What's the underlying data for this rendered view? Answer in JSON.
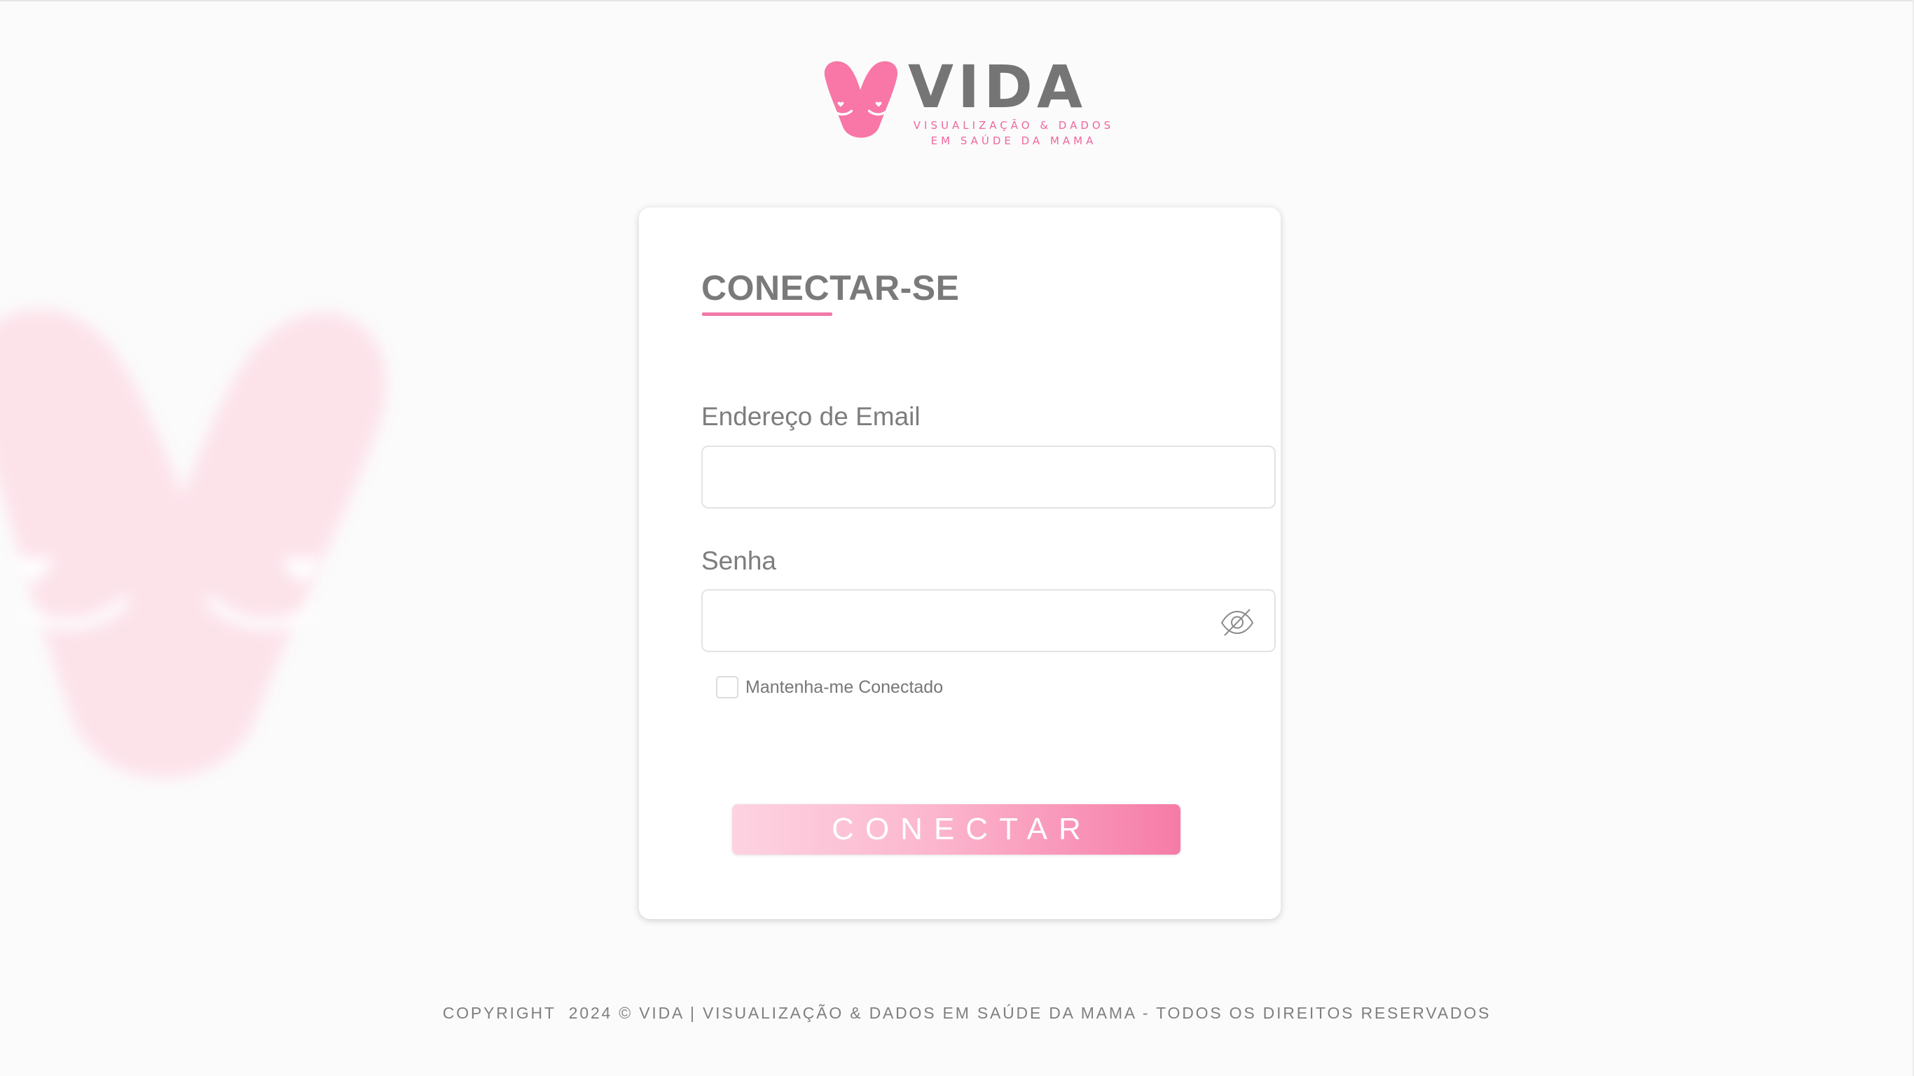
{
  "brand": {
    "name": "VIDA",
    "tagline_line1": "VISUALIZAÇÃO & DADOS",
    "tagline_line2": "EM SAÚDE DA MAMA",
    "logo_icon": "heart-breast-logo-icon",
    "accent_color": "#f0679e"
  },
  "login": {
    "title": "CONECTAR-SE",
    "email_label": "Endereço de Email",
    "email_value": "",
    "password_label": "Senha",
    "password_value": "",
    "password_toggle_icon": "eye-slash-icon",
    "remember_label": "Mantenha-me Conectado",
    "remember_checked": false,
    "submit_label": "CONECTAR"
  },
  "footer": {
    "text": "COPYRIGHT  2024 © VIDA | VISUALIZAÇÃO & DADOS EM SAÚDE DA MAMA - TODOS OS DIREITOS RESERVADOS"
  }
}
